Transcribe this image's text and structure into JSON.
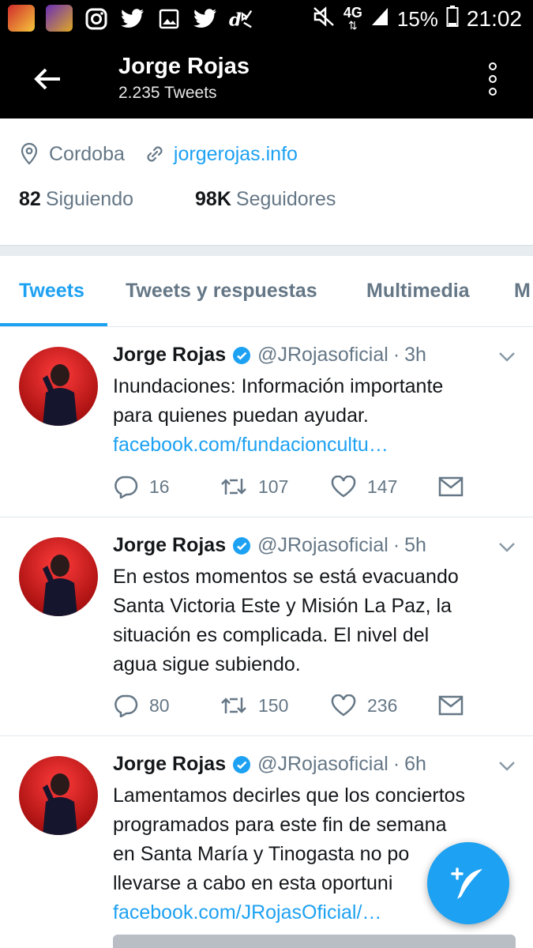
{
  "status_bar": {
    "network": "4G",
    "battery": "15%",
    "time": "21:02"
  },
  "header": {
    "title": "Jorge Rojas",
    "subtitle": "2.235 Tweets"
  },
  "profile": {
    "location": "Cordoba",
    "website": "jorgerojas.info",
    "following_count": "82",
    "following_label": "Siguiendo",
    "followers_count": "98K",
    "followers_label": "Seguidores"
  },
  "tabs": [
    {
      "label": "Tweets"
    },
    {
      "label": "Tweets y respuestas"
    },
    {
      "label": "Multimedia"
    },
    {
      "label": "M"
    }
  ],
  "tweets": [
    {
      "name": "Jorge Rojas",
      "handle": "@JRojasoficial",
      "dot": "·",
      "time": "3h",
      "lines": [
        "Inundaciones: Información importante",
        "para quienes puedan ayudar."
      ],
      "link": "facebook.com/fundacioncultu…",
      "replies": "16",
      "retweets": "107",
      "likes": "147"
    },
    {
      "name": "Jorge Rojas",
      "handle": "@JRojasoficial",
      "dot": "·",
      "time": "5h",
      "lines": [
        "En estos momentos se está evacuando",
        "Santa Victoria Este y Misión La Paz, la",
        "situación es complicada. El nivel del",
        "agua sigue subiendo."
      ],
      "link": "",
      "replies": "80",
      "retweets": "150",
      "likes": "236"
    },
    {
      "name": "Jorge Rojas",
      "handle": "@JRojasoficial",
      "dot": "·",
      "time": "6h",
      "lines": [
        "Lamentamos decirles que los conciertos",
        "programados para este fin de semana",
        "en Santa María y Tinogasta no po",
        "llevarse a cabo en esta oportuni"
      ],
      "link": "facebook.com/JRojasOficial/…"
    }
  ],
  "colors": {
    "accent": "#1da1f2",
    "secondary_text": "#657786",
    "bar_background": "#000000"
  },
  "icons": [
    "back-arrow-icon",
    "more-vertical-icon",
    "location-pin-icon",
    "link-icon",
    "verified-icon",
    "chevron-down-icon",
    "reply-icon",
    "retweet-icon",
    "like-icon",
    "dm-icon",
    "compose-tweet-icon"
  ]
}
